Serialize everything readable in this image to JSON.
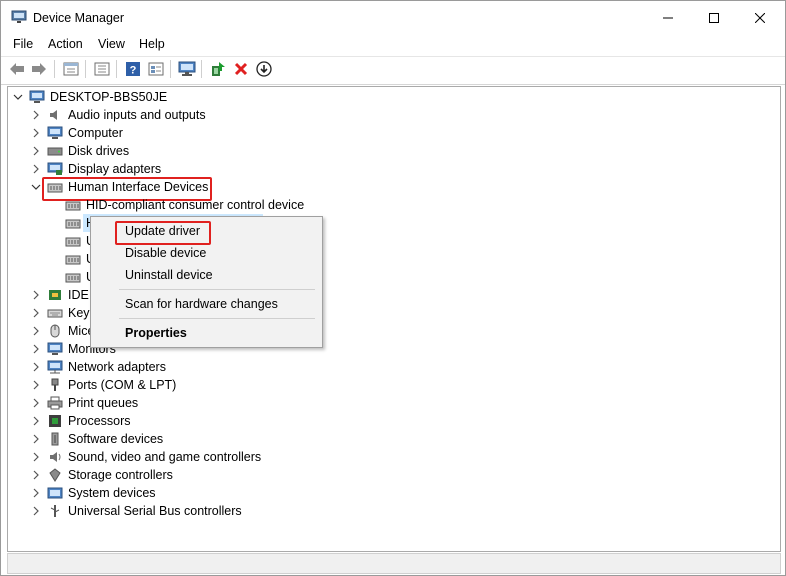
{
  "window": {
    "title": "Device Manager"
  },
  "menu": [
    "File",
    "Action",
    "View",
    "Help"
  ],
  "toolbar": [
    "back-icon",
    "forward-icon",
    "properties-sheet-icon",
    "show-hide-tree-icon",
    "help-icon",
    "view-icon",
    "scan-monitor-icon",
    "update-driver-icon",
    "uninstall-icon",
    "download-icon"
  ],
  "tree": {
    "root": "DESKTOP-BBS50JE",
    "categories": {
      "audio": "Audio inputs and outputs",
      "computer": "Computer",
      "disk": "Disk drives",
      "display": "Display adapters",
      "hid": "Human Interface Devices",
      "hid_child_0": "HID-compliant consumer control device",
      "hid_child_1": "H",
      "hid_child_2": "U",
      "hid_child_3": "U",
      "hid_child_4": "U",
      "ide": "IDE A",
      "keyboards": "Keyb",
      "mice": "Mice",
      "monitors": "Monitors",
      "network": "Network adapters",
      "ports": "Ports (COM & LPT)",
      "print": "Print queues",
      "processors": "Processors",
      "software": "Software devices",
      "sound": "Sound, video and game controllers",
      "storage": "Storage controllers",
      "system": "System devices",
      "usb": "Universal Serial Bus controllers"
    }
  },
  "context_menu": {
    "update": "Update driver",
    "disable": "Disable device",
    "uninstall": "Uninstall device",
    "scan": "Scan for hardware changes",
    "properties": "Properties"
  },
  "colors": {
    "highlight": "#e0211f",
    "selection": "#cce8ff"
  }
}
